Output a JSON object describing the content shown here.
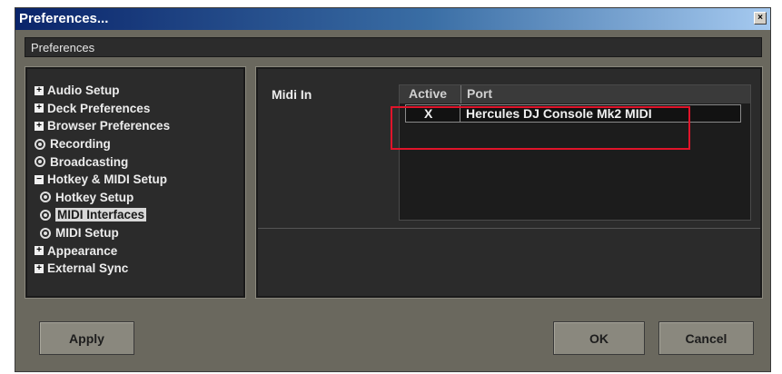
{
  "window": {
    "title": "Preferences...",
    "close_label": "×"
  },
  "header": {
    "title": "Preferences"
  },
  "tree": {
    "items": [
      {
        "label": "Audio Setup",
        "kind": "expand",
        "icon": "+"
      },
      {
        "label": "Deck Preferences",
        "kind": "expand",
        "icon": "+"
      },
      {
        "label": "Browser Preferences",
        "kind": "expand",
        "icon": "+"
      },
      {
        "label": "Recording",
        "kind": "leaf"
      },
      {
        "label": "Broadcasting",
        "kind": "leaf"
      },
      {
        "label": "Hotkey & MIDI Setup",
        "kind": "collapse",
        "icon": "−"
      },
      {
        "label": "Hotkey Setup",
        "kind": "child-leaf"
      },
      {
        "label": "MIDI Interfaces",
        "kind": "child-leaf",
        "selected": true
      },
      {
        "label": "MIDI Setup",
        "kind": "child-leaf"
      },
      {
        "label": "Appearance",
        "kind": "expand",
        "icon": "+"
      },
      {
        "label": "External Sync",
        "kind": "expand",
        "icon": "+"
      }
    ]
  },
  "midi": {
    "label": "Midi In",
    "columns": {
      "active": "Active",
      "port": "Port"
    },
    "rows": [
      {
        "active": "X",
        "port": "Hercules DJ Console Mk2 MIDI"
      }
    ]
  },
  "buttons": {
    "apply": "Apply",
    "ok": "OK",
    "cancel": "Cancel"
  },
  "colors": {
    "titlebar_start": "#0a246a",
    "titlebar_end": "#a6caf0",
    "highlight": "#e0142a"
  }
}
